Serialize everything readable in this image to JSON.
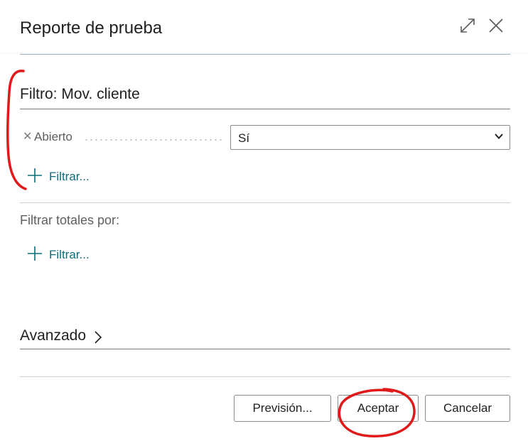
{
  "dialog": {
    "title": "Reporte de prueba"
  },
  "filter_section": {
    "title": "Filtro: Mov. cliente",
    "filters": [
      {
        "label": "Abierto",
        "value": "Sí"
      }
    ],
    "add_filter_label": "Filtrar..."
  },
  "totals_section": {
    "label": "Filtrar totales por:",
    "add_filter_label": "Filtrar..."
  },
  "advanced_section": {
    "title": "Avanzado"
  },
  "footer": {
    "preview_label": "Previsión...",
    "ok_label": "Aceptar",
    "cancel_label": "Cancelar"
  },
  "colors": {
    "accent": "#0f6b7a",
    "annotation": "#e0191b"
  },
  "icons": {
    "expand": "expand-icon",
    "close": "close-icon",
    "remove_filter": "remove-filter-icon",
    "add": "plus-icon",
    "dropdown": "chevron-down-icon",
    "advanced": "chevron-right-icon"
  }
}
